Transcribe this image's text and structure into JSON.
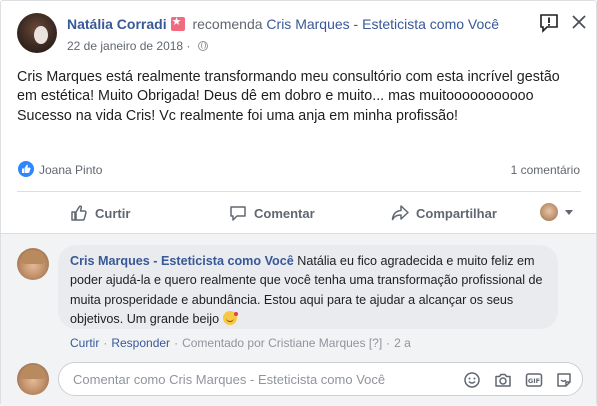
{
  "post": {
    "author": "Natália Corradi",
    "action": "recomenda",
    "page": "Cris Marques - Esteticista como Você",
    "date": "22 de janeiro de 2018",
    "dot": "·",
    "text": "Cris Marques está realmente transformando meu consultório com esta incrível gestão em estética! Muito Obrigada! Deus dê em dobro e muito... mas muitooooooooooo Sucesso na vida Cris! Vc realmente foi uma anja em minha profissão!",
    "reactor": "Joana Pinto",
    "comment_count": "1 comentário"
  },
  "actions": {
    "like": "Curtir",
    "comment": "Comentar",
    "share": "Compartilhar"
  },
  "comment": {
    "author": "Cris Marques - Esteticista como Você",
    "text": "Natália eu fico agradecida e muito feliz em poder ajudá-la e quero realmente que você tenha uma transformação profissional de muita prosperidade e abundância. Estou aqui para te ajudar a alcançar os seus objetivos. Um grande beijo",
    "like": "Curtir",
    "reply": "Responder",
    "commented_by": "Comentado por Cristiane Marques",
    "help_mark": "[?]",
    "time": "2 a",
    "sep": "·"
  },
  "composer": {
    "placeholder": "Comentar como Cris Marques - Esteticista como Você"
  },
  "colors": {
    "link": "#385898",
    "like_badge": "#2d88ff",
    "recommend_badge": "#f06b7f"
  },
  "icons": [
    "recommend-star-icon",
    "globe-icon",
    "report-icon",
    "more-icon",
    "like-icon",
    "comment-icon",
    "share-icon",
    "emoji-icon",
    "camera-icon",
    "gif-icon",
    "sticker-icon",
    "kiss-emoji-icon"
  ]
}
